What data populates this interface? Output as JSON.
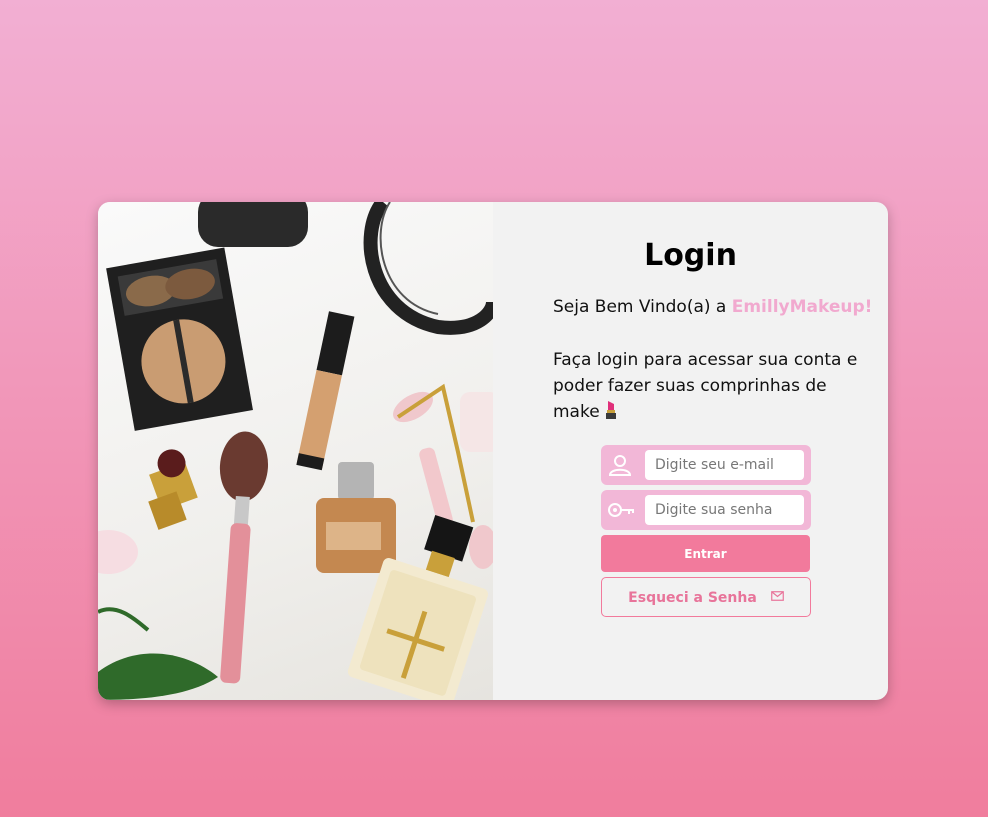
{
  "login": {
    "title": "Login",
    "welcome_prefix": "Seja Bem Vindo(a) a ",
    "brand": "EmillyMakeup!",
    "description": "Faça login para acessar sua conta e poder fazer suas comprinhas de make",
    "email_placeholder": "Digite seu e-mail",
    "password_placeholder": "Digite sua senha",
    "enter_label": "Entrar",
    "forgot_label": "Esqueci a Senha"
  },
  "icons": {
    "user": "user-icon",
    "key": "key-icon",
    "mail": "mail-icon",
    "lipstick": "lipstick-emoji"
  },
  "colors": {
    "brand_pink": "#f1a9cf",
    "button_pink": "#f27a9c",
    "field_pink": "#f2b7d7",
    "card_bg": "#f2f2f2"
  }
}
